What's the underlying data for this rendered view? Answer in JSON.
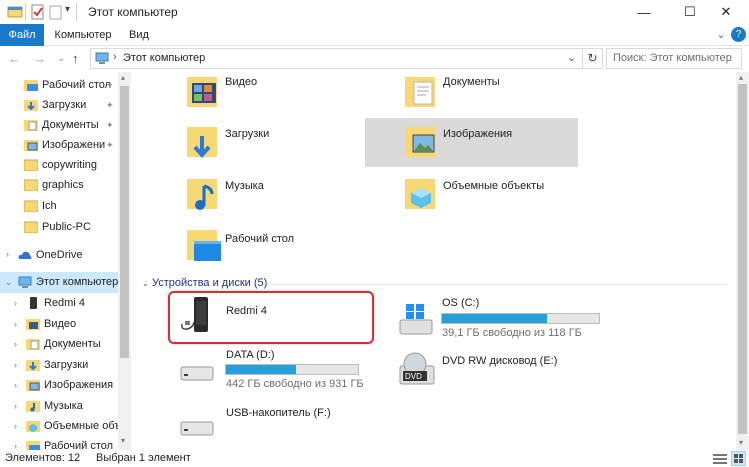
{
  "window": {
    "title": "Этот компьютер",
    "minimize_glyph": "—",
    "maximize_glyph": "☐",
    "close_glyph": "✕"
  },
  "ribbon": {
    "tabs": [
      "Файл",
      "Компьютер",
      "Вид"
    ],
    "expand_glyph": "⌄",
    "help_glyph": "?"
  },
  "nav": {
    "back": "←",
    "forward": "→",
    "recent": "⌄",
    "up": "↑"
  },
  "address": {
    "path": "Этот компьютер",
    "separator": "›",
    "dropdown": "⌄",
    "refresh": "↻"
  },
  "search": {
    "placeholder": "Поиск: Этот компьютер"
  },
  "sidebar": {
    "quick_access": [
      {
        "label": "Рабочий стол",
        "pinned": true
      },
      {
        "label": "Загрузки",
        "pinned": true
      },
      {
        "label": "Документы",
        "pinned": true
      },
      {
        "label": "Изображени",
        "pinned": true
      },
      {
        "label": "copywriting",
        "pinned": false
      },
      {
        "label": "graphics",
        "pinned": false
      },
      {
        "label": "Ich",
        "pinned": false
      },
      {
        "label": "Public-PC",
        "pinned": false
      }
    ],
    "onedrive": "OneDrive",
    "this_pc": "Этот компьютер",
    "this_pc_children": [
      "Redmi 4",
      "Видео",
      "Документы",
      "Загрузки",
      "Изображения",
      "Музыка",
      "Объемные объ",
      "Рабочий стол"
    ]
  },
  "folders": [
    {
      "label": "Видео",
      "icon": "video-folder-icon"
    },
    {
      "label": "Документы",
      "icon": "documents-folder-icon"
    },
    {
      "label": "Загрузки",
      "icon": "downloads-folder-icon"
    },
    {
      "label": "Изображения",
      "icon": "pictures-folder-icon",
      "selected": true
    },
    {
      "label": "Музыка",
      "icon": "music-folder-icon"
    },
    {
      "label": "Объемные объекты",
      "icon": "3d-objects-folder-icon"
    },
    {
      "label": "Рабочий стол",
      "icon": "desktop-folder-icon"
    }
  ],
  "devices_group": {
    "header": "Устройства и диски (5)"
  },
  "devices": [
    {
      "label": "Redmi 4",
      "icon": "phone-icon"
    },
    {
      "label": "OS (C:)",
      "free": "39,1 ГБ свободно из 118 ГБ",
      "used_fraction": 0.67,
      "icon": "windows-drive-icon"
    },
    {
      "label": "DATA (D:)",
      "free": "442 ГБ свободно из 931 ГБ",
      "used_fraction": 0.53,
      "icon": "hard-drive-icon"
    },
    {
      "label": "DVD RW дисковод (E:)",
      "icon": "dvd-drive-icon"
    },
    {
      "label": "USB-накопитель (F:)",
      "icon": "usb-drive-icon"
    }
  ],
  "status": {
    "items": "Элементов: 12",
    "selected": "Выбран 1 элемент"
  },
  "colors": {
    "accent": "#1979ca",
    "folder_yellow": "#f8d775",
    "selection": "#d9d9d9",
    "capacity_bar": "#26a0da",
    "highlight_border": "#c8353d"
  }
}
